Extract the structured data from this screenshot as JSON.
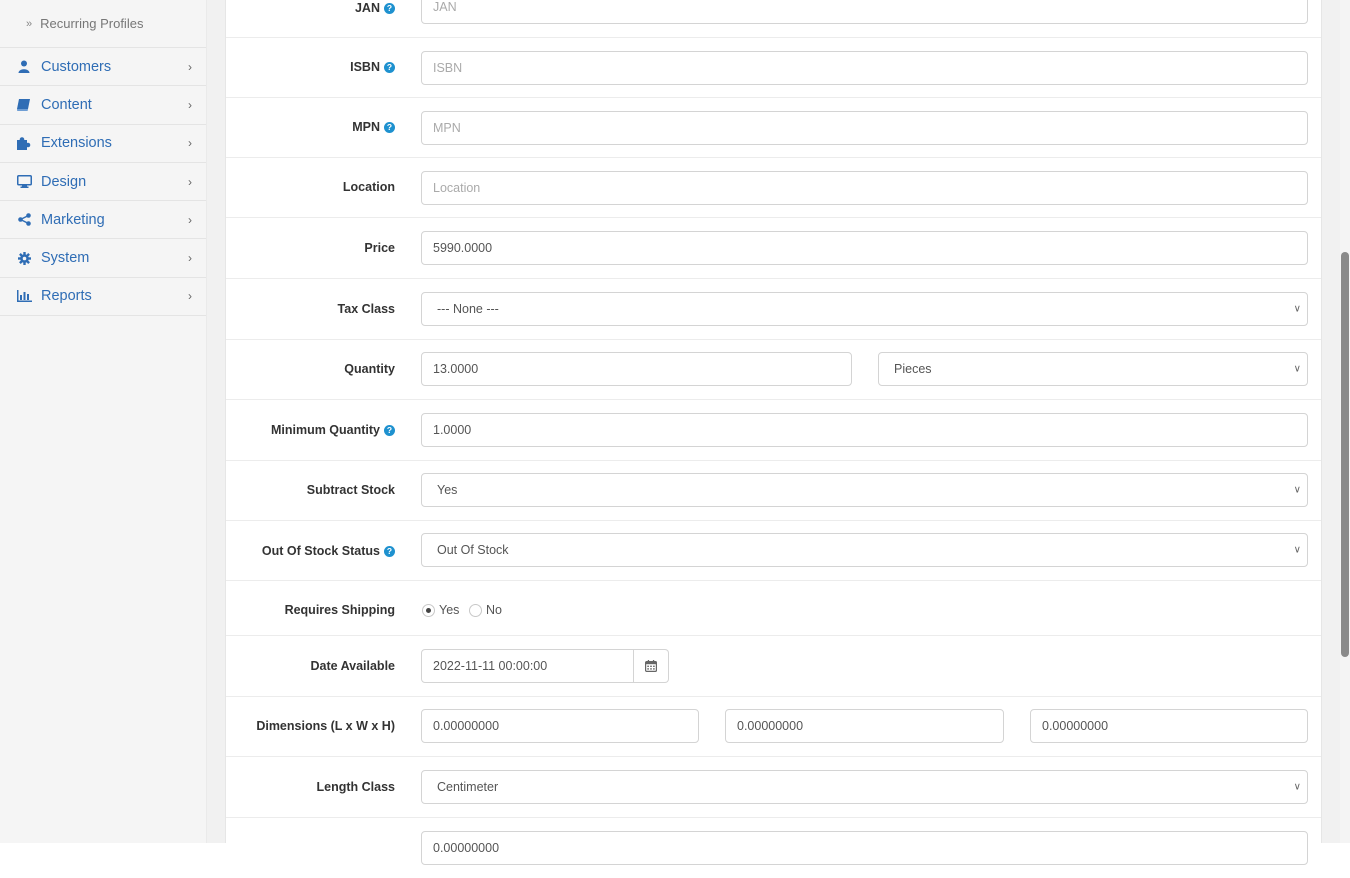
{
  "sidebar": {
    "sub_item": "Recurring Profiles",
    "items": [
      {
        "label": "Customers",
        "icon": "user-icon"
      },
      {
        "label": "Content",
        "icon": "book-icon"
      },
      {
        "label": "Extensions",
        "icon": "puzzle-icon"
      },
      {
        "label": "Design",
        "icon": "desktop-icon"
      },
      {
        "label": "Marketing",
        "icon": "share-icon"
      },
      {
        "label": "System",
        "icon": "gear-icon"
      },
      {
        "label": "Reports",
        "icon": "bar-chart-icon"
      }
    ]
  },
  "form": {
    "jan": {
      "label": "JAN",
      "placeholder": "JAN"
    },
    "isbn": {
      "label": "ISBN",
      "placeholder": "ISBN"
    },
    "mpn": {
      "label": "MPN",
      "placeholder": "MPN"
    },
    "location": {
      "label": "Location",
      "placeholder": "Location"
    },
    "price": {
      "label": "Price",
      "value": "5990.0000"
    },
    "tax_class": {
      "label": "Tax Class",
      "value": "--- None ---"
    },
    "quantity": {
      "label": "Quantity",
      "value": "13.0000",
      "unit": "Pieces"
    },
    "minimum_quantity": {
      "label": "Minimum Quantity",
      "value": "1.0000"
    },
    "subtract_stock": {
      "label": "Subtract Stock",
      "value": "Yes"
    },
    "out_of_stock_status": {
      "label": "Out Of Stock Status",
      "value": "Out Of Stock"
    },
    "requires_shipping": {
      "label": "Requires Shipping",
      "yes": "Yes",
      "no": "No",
      "selected": "Yes"
    },
    "date_available": {
      "label": "Date Available",
      "value": "2022-11-11 00:00:00"
    },
    "dimensions": {
      "label": "Dimensions (L x W x H)",
      "length": "0.00000000",
      "width": "0.00000000",
      "height": "0.00000000"
    },
    "length_class": {
      "label": "Length Class",
      "value": "Centimeter"
    },
    "weight": {
      "value": "0.00000000"
    }
  },
  "colors": {
    "nav_text": "#2f6db5",
    "help_icon": "#1e91cf"
  }
}
